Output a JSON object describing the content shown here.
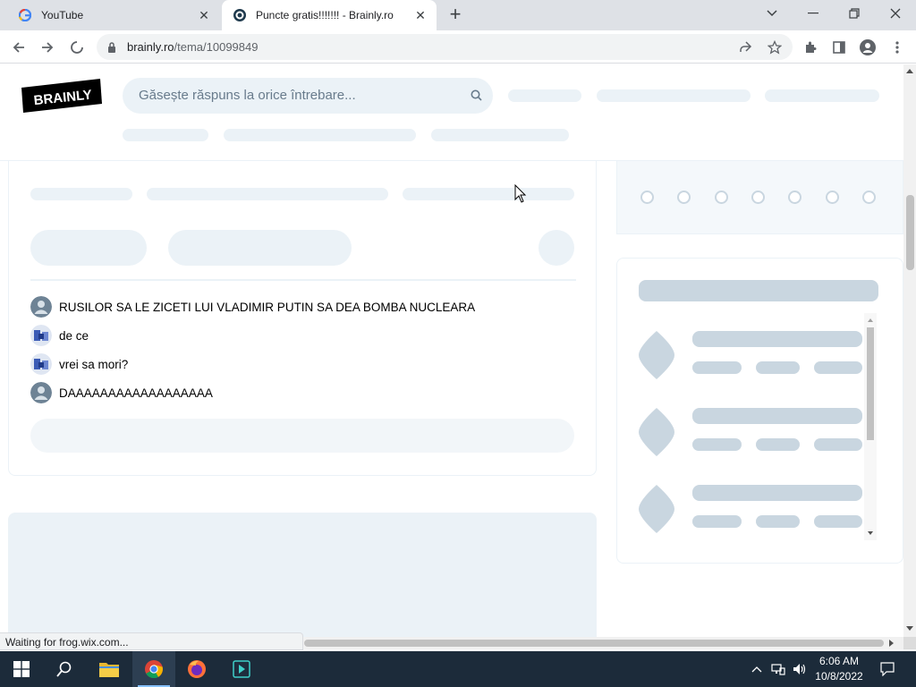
{
  "browser": {
    "tabs": [
      {
        "title": "YouTube",
        "active": false
      },
      {
        "title": "Puncte gratis!!!!!!! - Brainly.ro",
        "active": true
      }
    ],
    "url_host": "brainly.ro",
    "url_path": "/tema/10099849"
  },
  "page": {
    "logo_text": "BRAINLY",
    "search_placeholder": "Găsește răspuns la orice întrebare...",
    "comments": [
      {
        "text": "RUSILOR SA LE ZICETI LUI VLADIMIR PUTIN SA DEA BOMBA NUCLEARA",
        "avatar": "default"
      },
      {
        "text": "de ce",
        "avatar": "photo"
      },
      {
        "text": "vrei sa mori?",
        "avatar": "photo"
      },
      {
        "text": "DAAAAAAAAAAAAAAAAAA",
        "avatar": "default"
      }
    ]
  },
  "status_text": "Waiting for frog.wix.com...",
  "taskbar": {
    "time": "6:06 AM",
    "date": "10/8/2022"
  },
  "colors": {
    "brand": "#000000",
    "skeleton": "#ebf2f7",
    "skeleton_dark": "#c9d6e0"
  }
}
